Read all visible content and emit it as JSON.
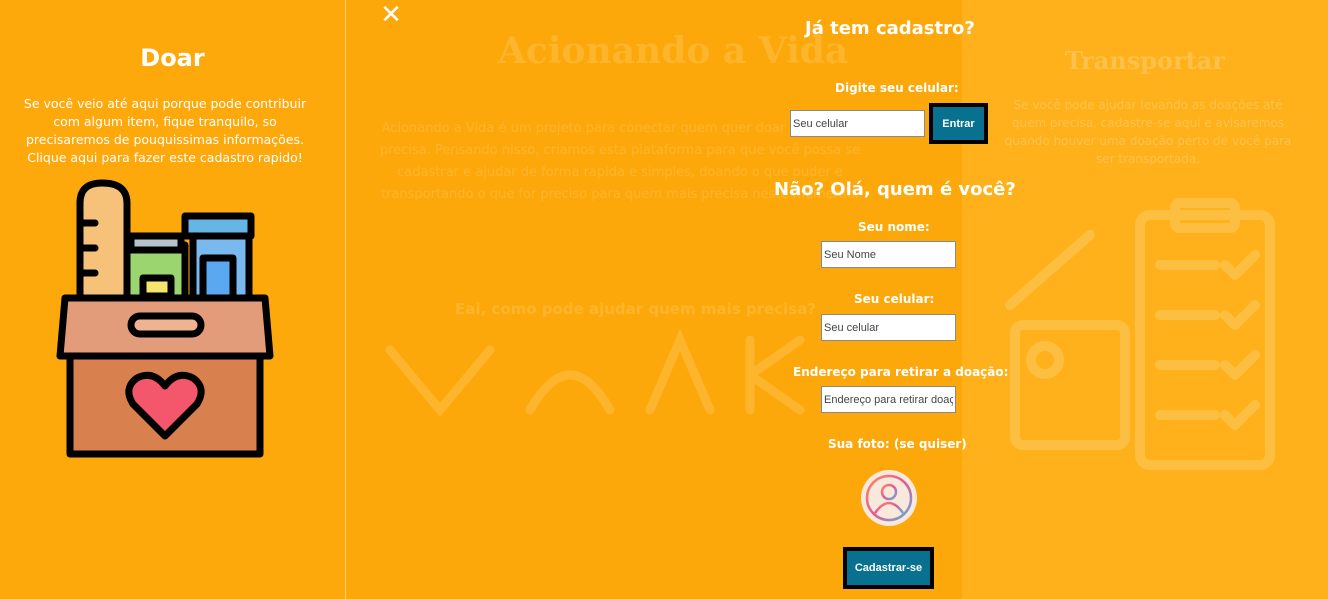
{
  "donate_panel": {
    "title": "Doar",
    "text": "Se você veio até aqui porque pode contribuir com algum item, fique tranquilo, so precisaremos de pouquissimas informações. Clique aqui para fazer este cadastro rapido!",
    "illustration": "donation-box-icon"
  },
  "background": {
    "title": "Acionando a Vida",
    "paragraph": "Acionando a Vida é um projeto para conectar quem quer doar com quem precisa. Pensando nisso, criamos esta plataforma para que você possa se cadastrar e ajudar de forma rapida e simples, doando o que puder e transportando o que for preciso para quem mais precisa neste momento.",
    "question": "Eai, como pode ajudar quem mais precisa?",
    "transport_title": "Transportar",
    "transport_text": "Se você pode ajudar levando as doações até quem precisa, cadastre-se aqui e avisaremos quando houver uma doação perto de você para ser transportada."
  },
  "modal": {
    "close_icon": "close-icon",
    "login_heading": "Já tem cadastro?",
    "login_phone_label": "Digite seu celular:",
    "login_phone_placeholder": "Seu celular",
    "login_button": "Entrar",
    "register_heading": "Não? Olá, quem é você?",
    "name_label": "Seu nome:",
    "name_placeholder": "Seu Nome",
    "phone_label": "Seu celular:",
    "phone_placeholder": "Seu celular",
    "address_label": "Endereço para retirar a doação:",
    "address_placeholder": "Endereço para retirar doação",
    "photo_label": "Sua foto: (se quiser)",
    "photo_icon": "user-avatar-icon",
    "register_button": "Cadastrar-se"
  },
  "colors": {
    "background": "#fda80a",
    "button": "#07718f",
    "text": "#ffffff"
  }
}
